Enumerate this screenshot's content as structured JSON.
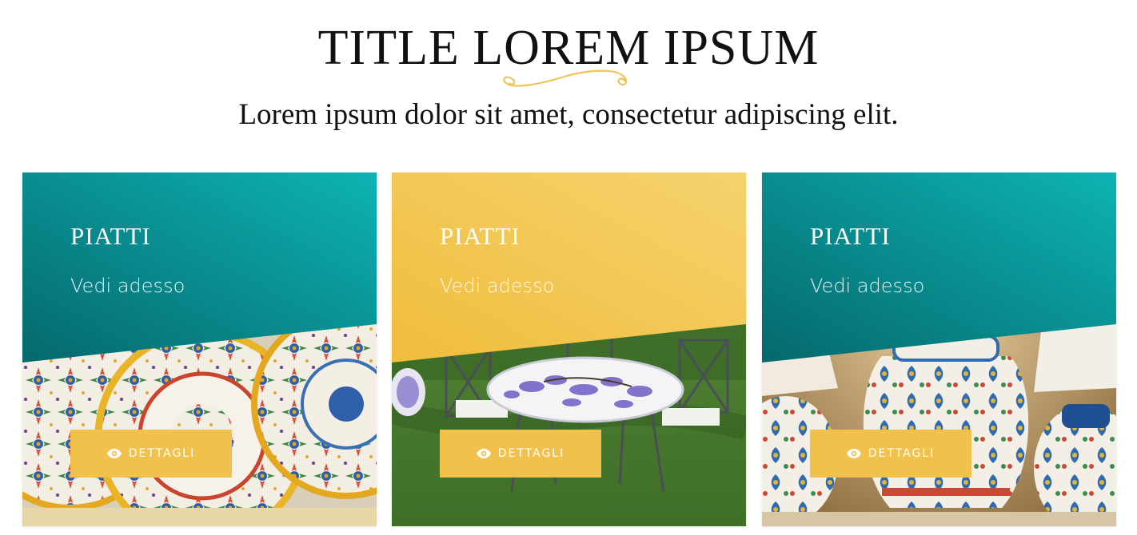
{
  "header": {
    "title": "TITLE LOREM IPSUM",
    "subtitle": "Lorem ipsum dolor sit amet, consectetur adipiscing elit."
  },
  "colors": {
    "teal": "#0a8a8c",
    "gold": "#f2c14b",
    "flourish": "#efc45a"
  },
  "cards": [
    {
      "title": "PIATTI",
      "link": "Vedi adesso",
      "button_label": "DETTAGLI",
      "button_icon": "eye-icon",
      "overlay_color": "teal",
      "photo": "decorated ceramic plates"
    },
    {
      "title": "PIATTI",
      "link": "Vedi adesso",
      "button_label": "DETTAGLI",
      "button_icon": "eye-icon",
      "overlay_color": "gold",
      "photo": "painted ceramic garden table with chairs"
    },
    {
      "title": "PIATTI",
      "link": "Vedi adesso",
      "button_label": "DETTAGLI",
      "button_icon": "eye-icon",
      "overlay_color": "teal",
      "photo": "pierced ceramic lamps"
    }
  ]
}
